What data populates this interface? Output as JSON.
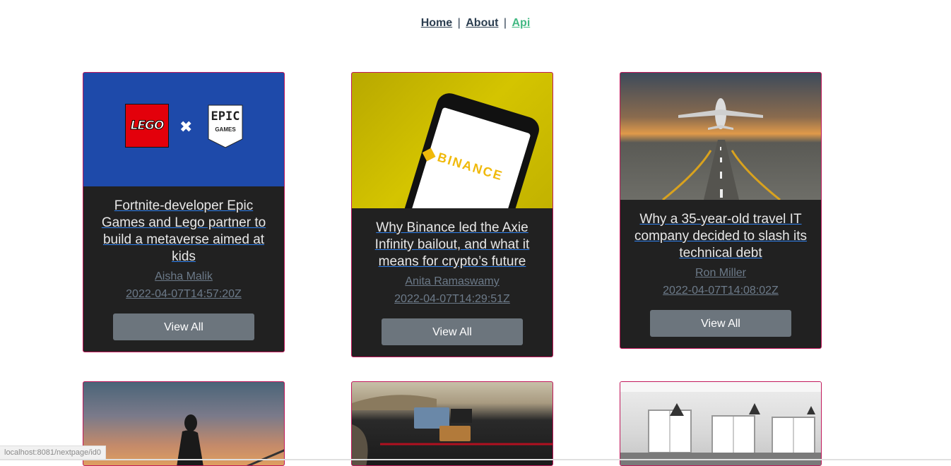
{
  "nav": {
    "home": "Home",
    "about": "About",
    "api": "Api",
    "separator": "|"
  },
  "cards": [
    {
      "title": "Fortnite-developer Epic Games and Lego partner to build a metaverse aimed at kids",
      "author": "Aisha Malik",
      "date": "2022-04-07T14:57:20Z",
      "button": "View All",
      "image": {
        "lego": "LEGO",
        "epic_top": "EPIC",
        "epic_bottom": "GAMES",
        "x": "✖"
      }
    },
    {
      "title": "Why Binance led the Axie Infinity bailout, and what it means for crypto’s future",
      "author": "Anita Ramaswamy",
      "date": "2022-04-07T14:29:51Z",
      "button": "View All",
      "image": {
        "brand": "BINANCE"
      }
    },
    {
      "title": "Why a 35-year-old travel IT company decided to slash its technical debt",
      "author": "Ron Miller",
      "date": "2022-04-07T14:08:02Z",
      "button": "View All"
    }
  ],
  "status_url": "localhost:8081/nextpage/id0",
  "colors": {
    "card_bg": "#212121",
    "card_border": "#c2185b",
    "button": "#6c757d",
    "nav_active": "#42b983",
    "nav_text": "#2c3e50"
  }
}
